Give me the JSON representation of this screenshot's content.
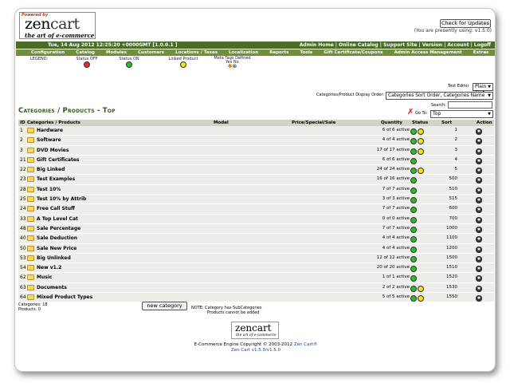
{
  "header": {
    "logo_powered": "Powered by",
    "logo_zen": "zen",
    "logo_cart": "cart",
    "logo_tagline": "the art of e-commerce",
    "update_button": "Check for Updates",
    "version_note": "(You are presently using: v1.5.0)"
  },
  "topbar": {
    "datetime": "Tue, 14 Aug 2012 12:25:20 +0000GMT [1.0.0.1 ]",
    "links": [
      "Admin Home",
      "Online Catalog",
      "Support Site",
      "Version",
      "Account",
      "Logoff"
    ]
  },
  "menu": [
    "Configuration",
    "Catalog",
    "Modules",
    "Customers",
    "Locations / Taxes",
    "Localization",
    "Reports",
    "Tools",
    "Gift Certificate/Coupons",
    "Admin Access Management",
    "Extras"
  ],
  "legend": {
    "title": "LEGEND:",
    "status_off": "Status OFF",
    "status_on": "Status ON",
    "linked": "Linked Product",
    "meta": "Meta Tags Defined",
    "meta_yesno": "Yes  No"
  },
  "controls": {
    "text_editor_label": "Text Editor",
    "text_editor_value": "Plain Text",
    "sort_order_label": "Categories/Product Display Order:",
    "sort_order_value": "Categories Sort Order, Categories Name",
    "search_label": "Search:",
    "goto_label": "Go To:",
    "goto_value": "Top"
  },
  "page_title": "Categories / Products - Top",
  "table": {
    "headers": {
      "id": "ID",
      "name": "Categories / Products",
      "model": "Model",
      "price": "Price/Special/Sale",
      "quantity": "Quantity",
      "status": "Status",
      "sort": "Sort",
      "action": "Action"
    },
    "rows": [
      {
        "id": "1",
        "name": "Hardware",
        "qty": "6 of 6 active",
        "linked": true,
        "sort": "1"
      },
      {
        "id": "2",
        "name": "Software",
        "qty": "4 of 4 active",
        "linked": true,
        "sort": "2"
      },
      {
        "id": "3",
        "name": "DVD Movies",
        "qty": "17 of 17 active",
        "linked": true,
        "sort": "3"
      },
      {
        "id": "21",
        "name": "Gift Certificates",
        "qty": "6 of 6 active",
        "linked": false,
        "sort": "4"
      },
      {
        "id": "22",
        "name": "Big Linked",
        "qty": "24 of 24 active",
        "linked": true,
        "sort": "5"
      },
      {
        "id": "23",
        "name": "Test Examples",
        "qty": "16 of 16 active",
        "linked": false,
        "sort": "500"
      },
      {
        "id": "28",
        "name": "Test 10%",
        "qty": "7 of 7 active",
        "linked": false,
        "sort": "510"
      },
      {
        "id": "25",
        "name": "Test 10% by Attrib",
        "qty": "3 of 3 active",
        "linked": false,
        "sort": "515"
      },
      {
        "id": "24",
        "name": "Free Call Stuff",
        "qty": "7 of 7 active",
        "linked": false,
        "sort": "600"
      },
      {
        "id": "33",
        "name": "A Top Level Cat",
        "qty": "0 of 0 active",
        "linked": false,
        "sort": "700"
      },
      {
        "id": "48",
        "name": "Sale Percentage",
        "qty": "7 of 7 active",
        "linked": false,
        "sort": "1000"
      },
      {
        "id": "40",
        "name": "Sale Deduction",
        "qty": "4 of 4 active",
        "linked": false,
        "sort": "1100"
      },
      {
        "id": "50",
        "name": "Sale New Price",
        "qty": "4 of 4 active",
        "linked": false,
        "sort": "1200"
      },
      {
        "id": "53",
        "name": "Big Unlinked",
        "qty": "12 of 12 active",
        "linked": false,
        "sort": "1500"
      },
      {
        "id": "54",
        "name": "New v1.2",
        "qty": "20 of 20 active",
        "linked": false,
        "sort": "1510"
      },
      {
        "id": "62",
        "name": "Music",
        "qty": "1 of 1 active",
        "linked": false,
        "sort": "1520"
      },
      {
        "id": "63",
        "name": "Documents",
        "qty": "2 of 2 active",
        "linked": true,
        "sort": "1530"
      },
      {
        "id": "64",
        "name": "Mixed Product Types",
        "qty": "5 of 5 active",
        "linked": true,
        "sort": "1550"
      }
    ]
  },
  "summary": {
    "categories": "Categories:  18",
    "products": "Products:  0",
    "new_category_button": "new category",
    "note_line1": "NOTE:  Category has SubCategories",
    "note_line2": "Products cannot be added"
  },
  "footer": {
    "logo_zen": "zen",
    "logo_cart": "cart",
    "logo_tagline": "the art of e-commerce",
    "copyright_text": "E-Commerce Engine Copyright © 2003-2012",
    "copyright_link": "Zen Cart®",
    "version_link": "Zen Cart v1.5.0/v1.5.0"
  },
  "colors": {
    "topbar": "#4b6b2a",
    "menubar": "#6f8f3c",
    "title": "#2f5a15",
    "status_on": "#2dba2d",
    "status_off": "#e32b2b",
    "linked": "#f2e21a"
  }
}
